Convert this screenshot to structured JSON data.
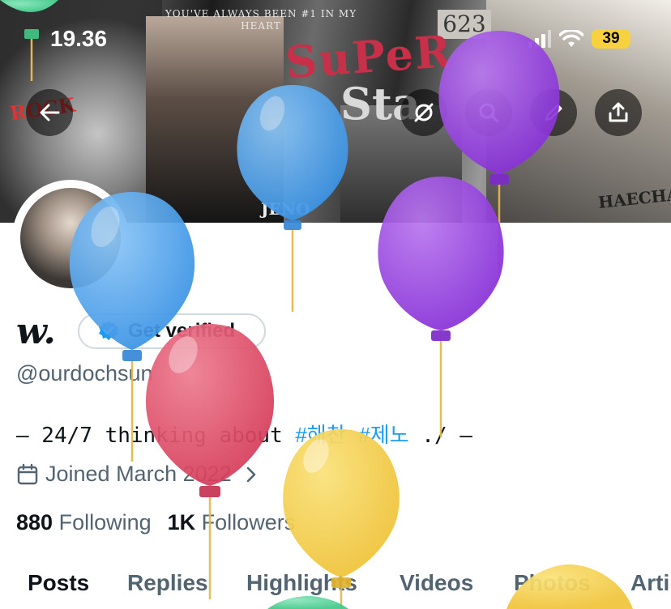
{
  "status_bar": {
    "time": "19.36",
    "battery": "39"
  },
  "banner": {
    "tagline": "YOU'VE ALWAYS BEEN #1 IN MY HEART",
    "superstar_top": "SuPeR",
    "superstar_bottom": "Sta",
    "counter": "623",
    "name_right": "HAECHAN",
    "name_left": "JENO",
    "rock": "ROCK"
  },
  "nav": {
    "back_icon": "arrow-left-icon",
    "grok_icon": "grok-icon",
    "search_icon": "search-icon",
    "edit_icon": "pencil-icon",
    "share_icon": "share-icon"
  },
  "profile": {
    "display_name": "w.",
    "verify_label": "Get verified",
    "handle": "@ourdochsun",
    "bio_prefix": "— 24/7 thinking about ",
    "bio_tag1": "#해찬",
    "bio_tag2": "#제노",
    "bio_suffix": " ./ —",
    "joined": "Joined March 2022",
    "following_count": "880",
    "following_label": "Following",
    "followers_count": "1K",
    "followers_label": "Followers"
  },
  "tabs": [
    "Posts",
    "Replies",
    "Highlights",
    "Videos",
    "Photos",
    "Arti"
  ],
  "colors": {
    "accent": "#1d9bf0",
    "secondary_text": "#536471",
    "balloon_blue": "#4aa3ef",
    "balloon_purple": "#9b43e0",
    "balloon_red": "#e0506a",
    "balloon_yellow": "#f4cf46",
    "balloon_green": "#59d49a"
  }
}
